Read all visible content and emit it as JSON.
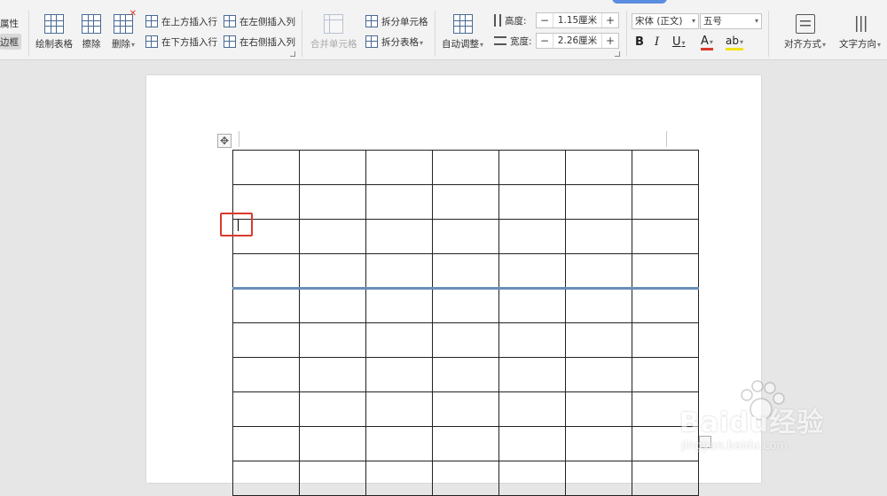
{
  "ribbon": {
    "table_properties_label": "属性",
    "border_label": "边框",
    "draw_table_label": "绘制表格",
    "erase_label": "擦除",
    "delete_label": "删除",
    "insert_row_above_label": "在上方插入行",
    "insert_row_below_label": "在下方插入行",
    "insert_col_left_label": "在左侧插入列",
    "insert_col_right_label": "在右侧插入列",
    "merge_cells_label": "合并单元格",
    "split_cells_label": "拆分单元格",
    "split_table_label": "拆分表格",
    "auto_fit_label": "自动调整",
    "height_label": "高度:",
    "height_value": "1.15厘米",
    "width_label": "宽度:",
    "width_value": "2.26厘米",
    "font_name": "宋体 (正文)",
    "font_size": "五号",
    "bold_label": "B",
    "italic_label": "I",
    "underline_label": "U",
    "font_color_label": "A",
    "highlight_label": "ab",
    "align_label": "对齐方式",
    "text_direction_label": "文字方向",
    "minus": "−",
    "plus": "+"
  },
  "document": {
    "table_rows": 10,
    "table_cols": 7,
    "thick_border_after_row": 4
  },
  "watermark": {
    "brand": "Baidu经验",
    "url": "jingyan.baidu.com"
  },
  "colors": {
    "accent": "#5b8de0",
    "highlight_box": "#d93a2b",
    "thick_border": "#6a8fb8"
  }
}
